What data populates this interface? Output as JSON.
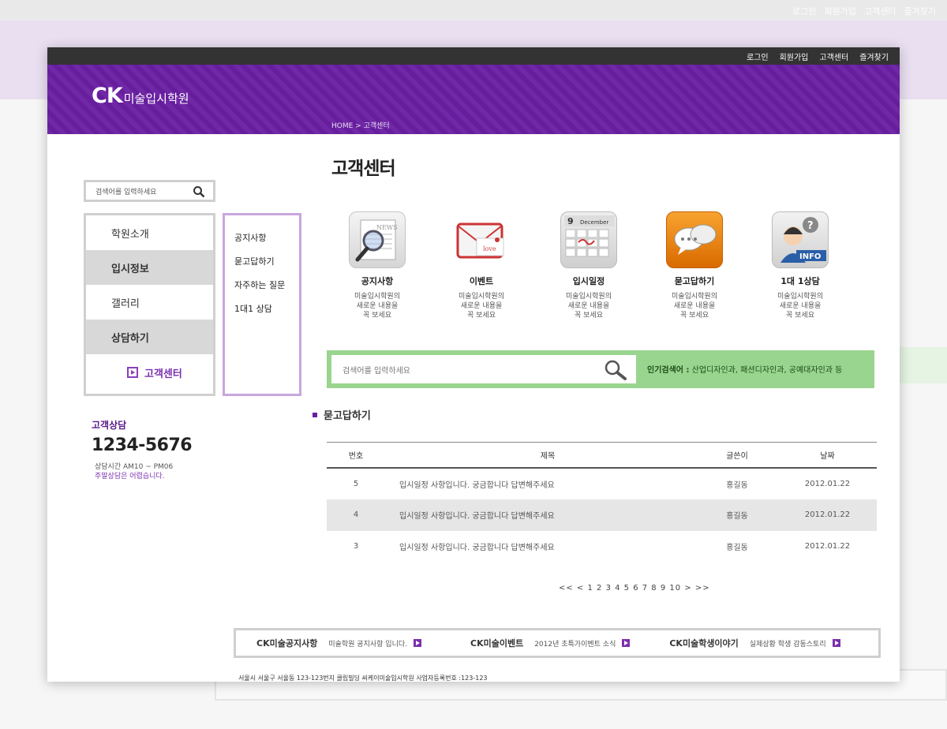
{
  "backdrop": {
    "topnav": [
      "로그인",
      "회원가입",
      "고객센터",
      "즐겨찾기"
    ]
  },
  "topnav": {
    "items": [
      "로그인",
      "회원가입",
      "고객센터",
      "즐겨찾기"
    ]
  },
  "header": {
    "logo_ck": "CK",
    "logo_name": "미술입시학원",
    "breadcrumb": "HOME > 고객센터"
  },
  "page_title": "고객센터",
  "left_search": {
    "placeholder": "검색어를 입력하세요"
  },
  "left_menu": {
    "items": [
      "학원소개",
      "입시정보",
      "갤러리",
      "상담하기"
    ],
    "current": "고객센터"
  },
  "submenu": {
    "items": [
      "공지사항",
      "묻고답하기",
      "자주하는 질문",
      "1대1 상담"
    ]
  },
  "contact": {
    "title": "고객상담",
    "phone": "1234-5676",
    "hours": "상담시간 AM10 ~ PM06",
    "weekend": "주말상담은 어렵습니다."
  },
  "icons": [
    {
      "label": "공지사항",
      "desc1": "미술입시학원의",
      "desc2": "새로운 내용을",
      "desc3": "꼭 보세요"
    },
    {
      "label": "이벤트",
      "desc1": "미술입시학원의",
      "desc2": "새로운 내용을",
      "desc3": "꼭 보세요"
    },
    {
      "label": "입시일정",
      "desc1": "미술입시학원의",
      "desc2": "새로운 내용을",
      "desc3": "꼭 보세요"
    },
    {
      "label": "묻고답하기",
      "desc1": "미술입시학원의",
      "desc2": "새로운 내용을",
      "desc3": "꼭 보세요"
    },
    {
      "label": "1대 1상담",
      "desc1": "미술입시학원의",
      "desc2": "새로운 내용을",
      "desc3": "꼭 보세요"
    }
  ],
  "icon_art": {
    "calendar_day": "9",
    "calendar_month": "December",
    "news": "NEWS",
    "love": "love",
    "info": "INFO"
  },
  "big_search": {
    "placeholder": "검색어를 입력하세요",
    "popular_label": "인기검색어 :",
    "popular_terms": "산업디자인과, 패션디자인과, 공예대자인과 등"
  },
  "section_title": "묻고답하기",
  "table": {
    "headers": [
      "번호",
      "제목",
      "글쓴이",
      "날짜"
    ],
    "rows": [
      {
        "no": "5",
        "title": "입시일정 사항입니다. 궁금합니다 답변해주세요",
        "writer": "홍길동",
        "date": "2012.01.22"
      },
      {
        "no": "4",
        "title": "입시일정 사항입니다. 궁금합니다 답변해주세요",
        "writer": "홍길동",
        "date": "2012.01.22"
      },
      {
        "no": "3",
        "title": "입시일정 사항입니다. 궁금합니다 답변해주세요",
        "writer": "홍길동",
        "date": "2012.01.22"
      }
    ]
  },
  "pager": {
    "text": "<< < 1 2 3 4 5 6 7 8 9 10 > >>"
  },
  "footer_strip": [
    {
      "name": "CK미술공지사항",
      "text": "미술학원 공지사항 입니다."
    },
    {
      "name": "CK미술이벤트",
      "text": "2012년 초특가이벤트 소식"
    },
    {
      "name": "CK미술학생이야기",
      "text": "실제상황 학생 감동스토리"
    }
  ],
  "address": "서울시 서울구 서울동 123-123번지 클립빌딩 씨케이미술입시학원 사업자등록번호 :123-123",
  "colors": {
    "purple": "#6a1fa3",
    "green": "#99d58e",
    "topbar": "#333333"
  }
}
